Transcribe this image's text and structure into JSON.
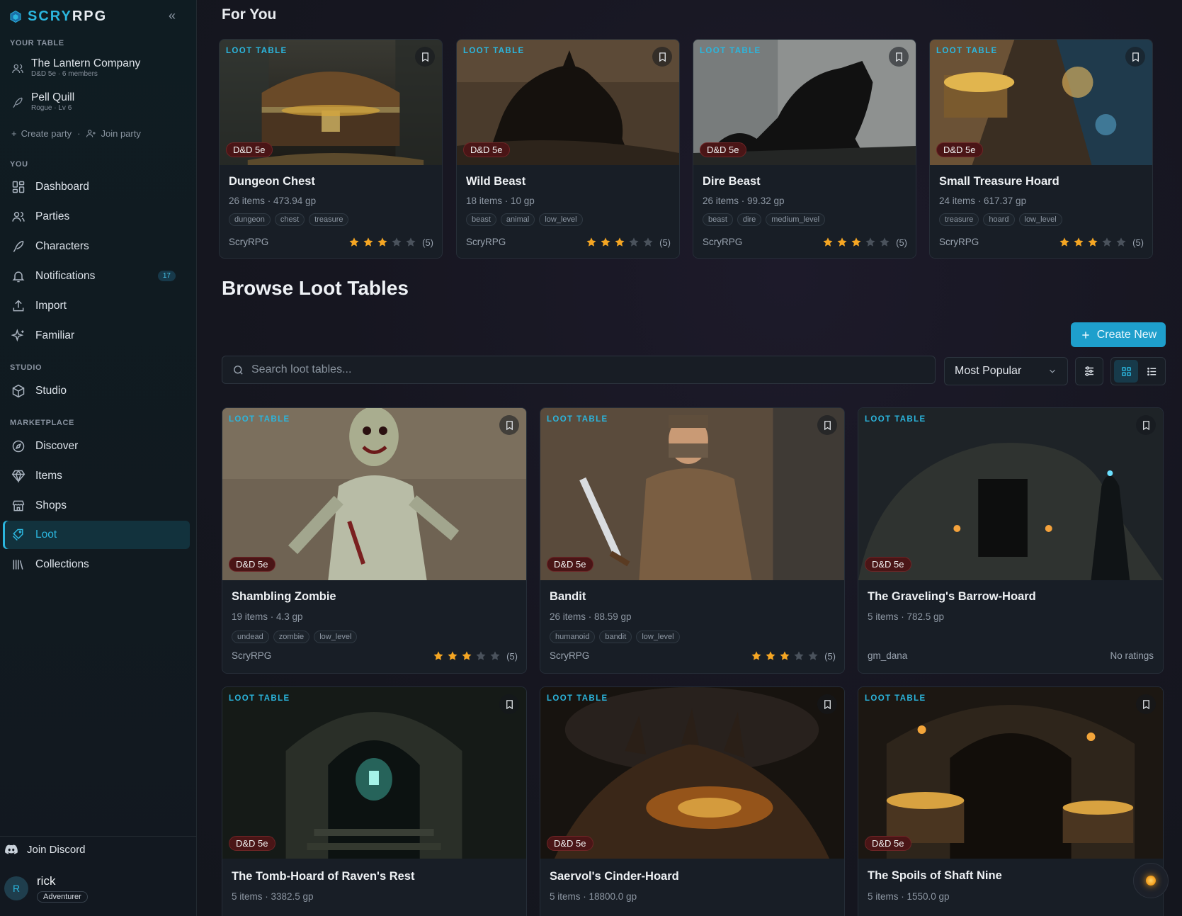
{
  "brand": {
    "prefix": "SCRY",
    "suffix": "RPG"
  },
  "sidebar": {
    "your_table_label": "YOUR TABLE",
    "table_entries": [
      {
        "name": "The Lantern Company",
        "sub": "D&D 5e · 6 members",
        "icon": "users-icon"
      },
      {
        "name": "Pell Quill",
        "sub": "Rogue · Lv 6",
        "icon": "quill-icon"
      }
    ],
    "create_party": "Create party",
    "join_party": "Join party",
    "you_label": "YOU",
    "you_items": [
      {
        "label": "Dashboard",
        "icon": "dashboard-icon"
      },
      {
        "label": "Parties",
        "icon": "users-icon"
      },
      {
        "label": "Characters",
        "icon": "quill-icon"
      },
      {
        "label": "Notifications",
        "icon": "bell-icon",
        "badge": "17"
      },
      {
        "label": "Import",
        "icon": "upload-icon"
      },
      {
        "label": "Familiar",
        "icon": "sparkles-icon"
      }
    ],
    "studio_label": "STUDIO",
    "studio_items": [
      {
        "label": "Studio",
        "icon": "cube-icon"
      }
    ],
    "marketplace_label": "MARKETPLACE",
    "marketplace_items": [
      {
        "label": "Discover",
        "icon": "compass-icon"
      },
      {
        "label": "Items",
        "icon": "gem-icon"
      },
      {
        "label": "Shops",
        "icon": "store-icon"
      },
      {
        "label": "Loot",
        "icon": "loot-icon",
        "active": true
      },
      {
        "label": "Collections",
        "icon": "library-icon"
      }
    ],
    "discord": "Join Discord",
    "user": {
      "initial": "R",
      "name": "rick",
      "role": "Adventurer"
    }
  },
  "for_you": {
    "heading": "For You",
    "cards": [
      {
        "type": "LOOT TABLE",
        "system": "D&D 5e",
        "title": "Dungeon Chest",
        "meta": "26 items · 473.94 gp",
        "tags": [
          "dungeon",
          "chest",
          "treasure"
        ],
        "author": "ScryRPG",
        "rating": 3,
        "rating_count": "(5)"
      },
      {
        "type": "LOOT TABLE",
        "system": "D&D 5e",
        "title": "Wild Beast",
        "meta": "18 items · 10 gp",
        "tags": [
          "beast",
          "animal",
          "low_level"
        ],
        "author": "ScryRPG",
        "rating": 3,
        "rating_count": "(5)"
      },
      {
        "type": "LOOT TABLE",
        "system": "D&D 5e",
        "title": "Dire Beast",
        "meta": "26 items · 99.32 gp",
        "tags": [
          "beast",
          "dire",
          "medium_level"
        ],
        "author": "ScryRPG",
        "rating": 3,
        "rating_count": "(5)"
      },
      {
        "type": "LOOT TABLE",
        "system": "D&D 5e",
        "title": "Small Treasure Hoard",
        "meta": "24 items · 617.37 gp",
        "tags": [
          "treasure",
          "hoard",
          "low_level"
        ],
        "author": "ScryRPG",
        "rating": 3,
        "rating_count": "(5)"
      }
    ]
  },
  "browse": {
    "heading": "Browse Loot Tables",
    "create_new": "Create New",
    "search_placeholder": "Search loot tables...",
    "sort_value": "Most Popular",
    "cards": [
      {
        "type": "LOOT TABLE",
        "system": "D&D 5e",
        "title": "Shambling Zombie",
        "meta": "19 items · 4.3 gp",
        "tags": [
          "undead",
          "zombie",
          "low_level"
        ],
        "author": "ScryRPG",
        "rating": 3,
        "rating_count": "(5)"
      },
      {
        "type": "LOOT TABLE",
        "system": "D&D 5e",
        "title": "Bandit",
        "meta": "26 items · 88.59 gp",
        "tags": [
          "humanoid",
          "bandit",
          "low_level"
        ],
        "author": "ScryRPG",
        "rating": 3,
        "rating_count": "(5)"
      },
      {
        "type": "LOOT TABLE",
        "system": "D&D 5e",
        "title": "The Graveling's Barrow-Hoard",
        "meta": "5 items · 782.5 gp",
        "tags": [],
        "author": "gm_dana",
        "no_ratings": "No ratings"
      },
      {
        "type": "LOOT TABLE",
        "system": "D&D 5e",
        "title": "The Tomb-Hoard of Raven's Rest",
        "meta": "5 items · 3382.5 gp"
      },
      {
        "type": "LOOT TABLE",
        "system": "D&D 5e",
        "title": "Saervol's Cinder-Hoard",
        "meta": "5 items · 18800.0 gp"
      },
      {
        "type": "LOOT TABLE",
        "system": "D&D 5e",
        "title": "The Spoils of Shaft Nine",
        "meta": "5 items · 1550.0 gp"
      }
    ]
  },
  "colors": {
    "accent": "#2bb6de",
    "system_badge": "#4a1516",
    "star": "#f5a623",
    "star_empty": "#4a525c"
  }
}
